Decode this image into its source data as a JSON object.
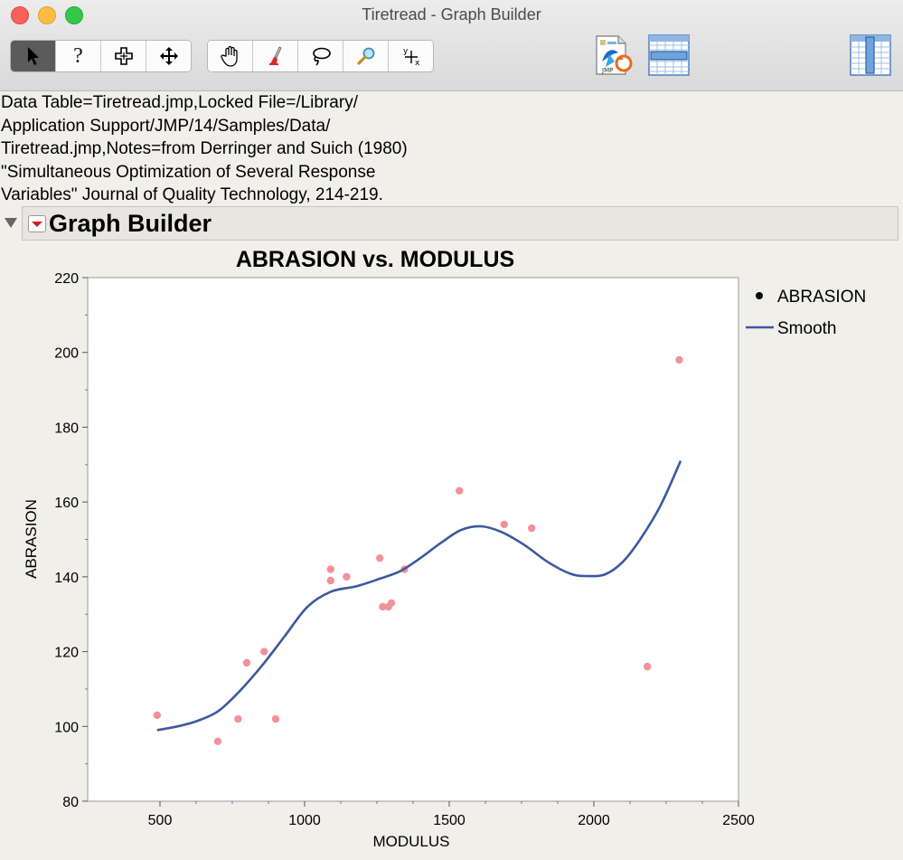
{
  "window": {
    "title": "Tiretread - Graph Builder"
  },
  "toolbar": {
    "tools": [
      {
        "icon": "arrow-pointer-icon",
        "glyph": "➤"
      },
      {
        "icon": "help-question-icon",
        "glyph": "?"
      },
      {
        "icon": "crosshair-icon",
        "glyph": "⊕"
      },
      {
        "icon": "move-arrows-icon",
        "glyph": "✥"
      },
      {
        "icon": "hand-grabber-icon",
        "glyph": "✋"
      },
      {
        "icon": "brush-icon",
        "glyph": "🖌"
      },
      {
        "icon": "lasso-icon",
        "glyph": "➰"
      },
      {
        "icon": "magnifier-icon",
        "glyph": "🔍"
      },
      {
        "icon": "annotate-xy-icon",
        "glyph": "ʸ+ₓ"
      }
    ]
  },
  "notes": {
    "lines": [
      "Data Table=Tiretread.jmp,Locked File=/Library/",
      "Application Support/JMP/14/Samples/Data/",
      "Tiretread.jmp,Notes=from Derringer and Suich (1980)",
      "\"Simultaneous Optimization of Several Response",
      "Variables\" Journal of Quality Technology, 214-219."
    ]
  },
  "report": {
    "title": "Graph Builder"
  },
  "colors": {
    "points": "#f4909a",
    "smooth": "#3c58a0",
    "legend_marker": "#000000"
  },
  "chart_data": {
    "type": "scatter",
    "title": "ABRASION vs. MODULUS",
    "xlabel": "MODULUS",
    "ylabel": "ABRASION",
    "xlim": [
      250,
      2500
    ],
    "ylim": [
      80,
      220
    ],
    "xticks": [
      500,
      1000,
      1500,
      2000,
      2500
    ],
    "yticks": [
      80,
      100,
      120,
      140,
      160,
      180,
      200,
      220
    ],
    "grid": false,
    "legend": {
      "position": "right",
      "entries": [
        {
          "label": "ABRASION",
          "kind": "marker"
        },
        {
          "label": "Smooth",
          "kind": "line"
        }
      ]
    },
    "series": [
      {
        "name": "ABRASION",
        "kind": "points",
        "x": [
          490,
          700,
          770,
          800,
          860,
          900,
          1090,
          1090,
          1145,
          1260,
          1270,
          1290,
          1300,
          1345,
          1535,
          1690,
          1785,
          2185,
          2295
        ],
        "y": [
          103,
          96,
          102,
          117,
          120,
          102,
          142,
          139,
          140,
          145,
          132,
          132,
          133,
          142,
          163,
          154,
          153,
          116,
          198
        ]
      },
      {
        "name": "Smooth",
        "kind": "line",
        "x": [
          490,
          560,
          630,
          700,
          770,
          850,
          930,
          1010,
          1090,
          1180,
          1260,
          1330,
          1400,
          1470,
          1540,
          1610,
          1680,
          1760,
          1840,
          1920,
          1980,
          2040,
          2100,
          2160,
          2230,
          2300
        ],
        "y": [
          99,
          100,
          101.5,
          104,
          109,
          116,
          124,
          132,
          136,
          137.5,
          139.5,
          141.5,
          145,
          149,
          152.5,
          153.5,
          152,
          148.5,
          144,
          140.8,
          140.2,
          140.7,
          144,
          150,
          159,
          171
        ]
      }
    ]
  }
}
